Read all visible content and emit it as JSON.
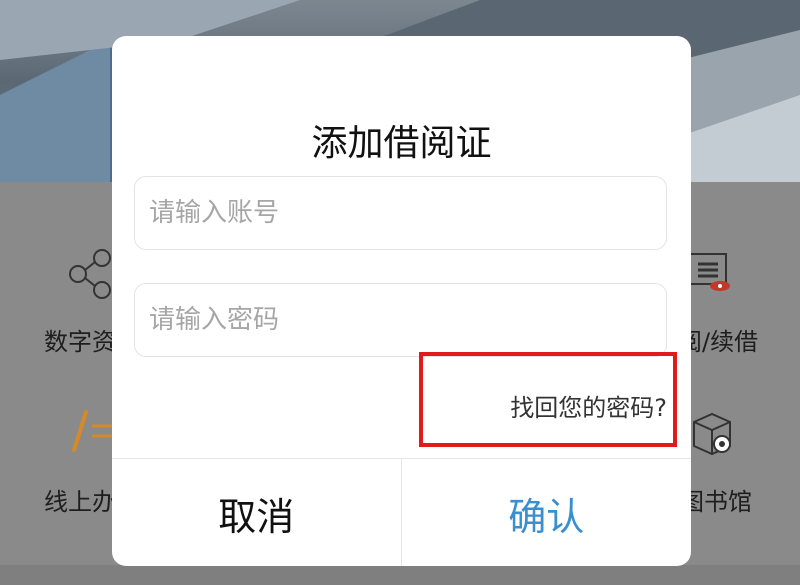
{
  "background": {
    "items": [
      {
        "label": "数字资"
      },
      {
        "label": "阅/续借"
      },
      {
        "label": "线上办"
      },
      {
        "label": "图书馆"
      }
    ]
  },
  "dialog": {
    "title": "添加借阅证",
    "account_placeholder": "请输入账号",
    "password_placeholder": "请输入密码",
    "forgot_label": "找回您的密码?",
    "cancel_label": "取消",
    "confirm_label": "确认"
  },
  "colors": {
    "confirm": "#3a8fd0",
    "highlight": "#e11b1b"
  }
}
